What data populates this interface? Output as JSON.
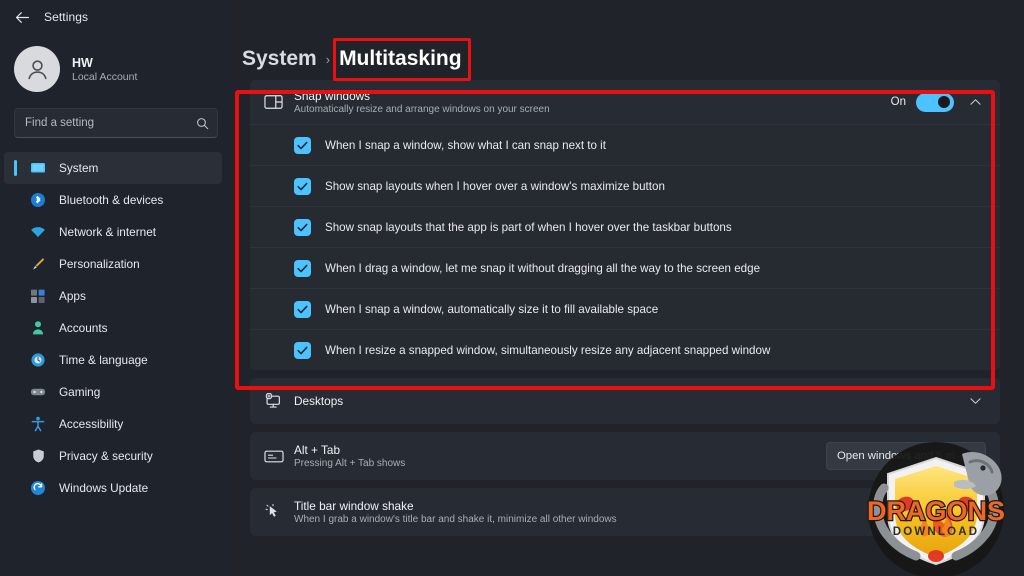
{
  "window": {
    "title": "Settings",
    "back_icon": "back-arrow-icon"
  },
  "account": {
    "name": "HW",
    "type": "Local Account",
    "avatar_icon": "person-icon"
  },
  "search": {
    "placeholder": "Find a setting",
    "value": "",
    "icon": "search-icon"
  },
  "sidebar": {
    "items": [
      {
        "label": "System",
        "icon": "monitor-icon",
        "active": true
      },
      {
        "label": "Bluetooth & devices",
        "icon": "bluetooth-icon",
        "active": false
      },
      {
        "label": "Network & internet",
        "icon": "wifi-icon",
        "active": false
      },
      {
        "label": "Personalization",
        "icon": "brush-icon",
        "active": false
      },
      {
        "label": "Apps",
        "icon": "apps-icon",
        "active": false
      },
      {
        "label": "Accounts",
        "icon": "account-icon",
        "active": false
      },
      {
        "label": "Time & language",
        "icon": "clock-globe-icon",
        "active": false
      },
      {
        "label": "Gaming",
        "icon": "gamepad-icon",
        "active": false
      },
      {
        "label": "Accessibility",
        "icon": "accessibility-icon",
        "active": false
      },
      {
        "label": "Privacy & security",
        "icon": "shield-icon",
        "active": false
      },
      {
        "label": "Windows Update",
        "icon": "update-refresh-icon",
        "active": false
      }
    ]
  },
  "breadcrumb": {
    "parent": "System",
    "separator": "›",
    "current": "Multitasking"
  },
  "snap_windows": {
    "title": "Snap windows",
    "subtitle": "Automatically resize and arrange windows on your screen",
    "icon": "snap-layout-icon",
    "toggle_label": "On",
    "toggle_on": true,
    "expand_icon": "chevron-up-icon",
    "options": [
      {
        "label": "When I snap a window, show what I can snap next to it",
        "checked": true
      },
      {
        "label": "Show snap layouts when I hover over a window's maximize button",
        "checked": true
      },
      {
        "label": "Show snap layouts that the app is part of when I hover over the taskbar buttons",
        "checked": true
      },
      {
        "label": "When I drag a window, let me snap it without dragging all the way to the screen edge",
        "checked": true
      },
      {
        "label": "When I snap a window, automatically size it to fill available space",
        "checked": true
      },
      {
        "label": "When I resize a snapped window, simultaneously resize any adjacent snapped window",
        "checked": true
      }
    ]
  },
  "desktops": {
    "title": "Desktops",
    "icon": "desktop-add-icon",
    "expand_icon": "chevron-down-icon"
  },
  "alt_tab": {
    "title": "Alt + Tab",
    "subtitle": "Pressing Alt + Tab shows",
    "icon": "alt-tab-icon",
    "dropdown_value": "Open windows and 5 m"
  },
  "title_bar_shake": {
    "title": "Title bar window shake",
    "subtitle": "When I grab a window's title bar and shake it, minimize all other windows",
    "icon": "cursor-shake-icon"
  },
  "watermark": {
    "main_text": "DRAGONS",
    "sub_text": "DOWNLOAD"
  },
  "colors": {
    "accent": "#4cc2ff",
    "annotation_red": "#e81010",
    "card_bg": "#272b33",
    "page_bg": "#202329",
    "sidebar_bg": "#1f232b"
  }
}
